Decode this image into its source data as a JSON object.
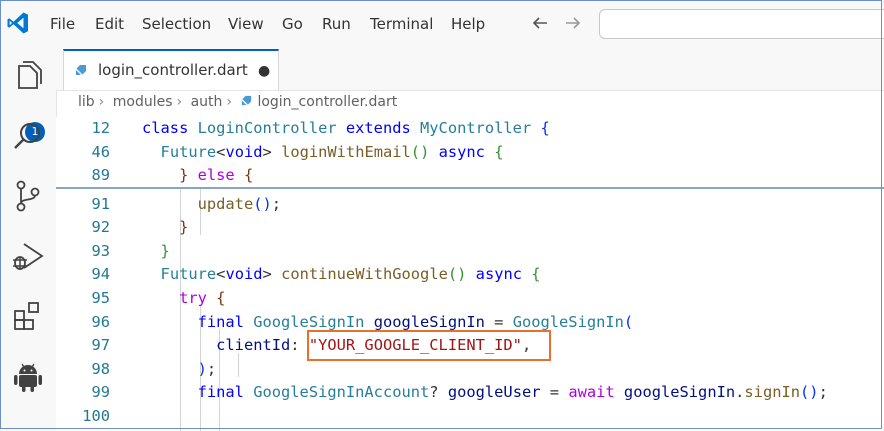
{
  "menu": {
    "items": [
      "File",
      "Edit",
      "Selection",
      "View",
      "Go",
      "Run",
      "Terminal",
      "Help"
    ]
  },
  "nav": {
    "back_icon": "arrow-left-icon",
    "forward_icon": "arrow-right-icon"
  },
  "activity_bar": {
    "icons": [
      "explorer-icon",
      "search-icon",
      "source-control-icon",
      "run-debug-icon",
      "extensions-icon",
      "android-icon"
    ],
    "explorer_badge": "1"
  },
  "tab": {
    "label": "login_controller.dart",
    "dirty_marker": "●"
  },
  "breadcrumb": {
    "parts": [
      "lib",
      "modules",
      "auth",
      "login_controller.dart"
    ]
  },
  "colors": {
    "accent": "#005fb8",
    "highlight_box": "#e8702a"
  },
  "editor": {
    "lines": [
      {
        "num": "12",
        "tokens": [
          [
            "kw",
            "class "
          ],
          [
            "ty",
            "LoginController "
          ],
          [
            "kw",
            "extends "
          ],
          [
            "ty",
            "MyController "
          ],
          [
            "br1",
            "{"
          ]
        ]
      },
      {
        "num": "46",
        "tokens": [
          [
            "",
            "  "
          ],
          [
            "ty",
            "Future"
          ],
          [
            "",
            "<"
          ],
          [
            "kw",
            "void"
          ],
          [
            "",
            "> "
          ],
          [
            "fn",
            "loginWithEmail"
          ],
          [
            "br2",
            "()"
          ],
          [
            "kw",
            " async "
          ],
          [
            "br2",
            "{"
          ]
        ]
      },
      {
        "num": "89",
        "tokens": [
          [
            "",
            "    "
          ],
          [
            "br3",
            "}"
          ],
          [
            "ctl",
            " else "
          ],
          [
            "br3",
            "{"
          ]
        ]
      },
      {
        "num": "91",
        "tokens": [
          [
            "",
            "      "
          ],
          [
            "fn",
            "update"
          ],
          [
            "br1",
            "()"
          ],
          [
            "",
            ";"
          ]
        ]
      },
      {
        "num": "92",
        "tokens": [
          [
            "",
            "    "
          ],
          [
            "br3",
            "}"
          ]
        ]
      },
      {
        "num": "93",
        "tokens": [
          [
            "",
            "  "
          ],
          [
            "br2",
            "}"
          ]
        ]
      },
      {
        "num": "94",
        "tokens": [
          [
            "",
            "  "
          ],
          [
            "ty",
            "Future"
          ],
          [
            "",
            "<"
          ],
          [
            "kw",
            "void"
          ],
          [
            "",
            "> "
          ],
          [
            "fn",
            "continueWithGoogle"
          ],
          [
            "br2",
            "()"
          ],
          [
            "kw",
            " async "
          ],
          [
            "br2",
            "{"
          ]
        ]
      },
      {
        "num": "95",
        "tokens": [
          [
            "",
            "    "
          ],
          [
            "ctl",
            "try "
          ],
          [
            "br3",
            "{"
          ]
        ]
      },
      {
        "num": "96",
        "tokens": [
          [
            "",
            "      "
          ],
          [
            "kw",
            "final "
          ],
          [
            "ty",
            "GoogleSignIn "
          ],
          [
            "vr",
            "googleSignIn "
          ],
          [
            "",
            "= "
          ],
          [
            "ty",
            "GoogleSignIn"
          ],
          [
            "br1",
            "("
          ]
        ]
      },
      {
        "num": "97",
        "tokens": [
          [
            "",
            "        "
          ],
          [
            "vr",
            "clientId"
          ],
          [
            "",
            ": "
          ],
          [
            "str",
            "\"YOUR_GOOGLE_CLIENT_ID\""
          ],
          [
            "",
            ","
          ]
        ]
      },
      {
        "num": "98",
        "tokens": [
          [
            "",
            "      "
          ],
          [
            "br1",
            ")"
          ],
          [
            "",
            ";"
          ]
        ]
      },
      {
        "num": "99",
        "tokens": [
          [
            "",
            "      "
          ],
          [
            "kw",
            "final "
          ],
          [
            "ty",
            "GoogleSignInAccount"
          ],
          [
            "",
            "? "
          ],
          [
            "vr",
            "googleUser "
          ],
          [
            "",
            "= "
          ],
          [
            "ctl",
            "await "
          ],
          [
            "vr",
            "googleSignIn"
          ],
          [
            "",
            "."
          ],
          [
            "fn",
            "signIn"
          ],
          [
            "br1",
            "()"
          ],
          [
            "",
            ";"
          ]
        ]
      },
      {
        "num": "100",
        "tokens": []
      }
    ]
  }
}
